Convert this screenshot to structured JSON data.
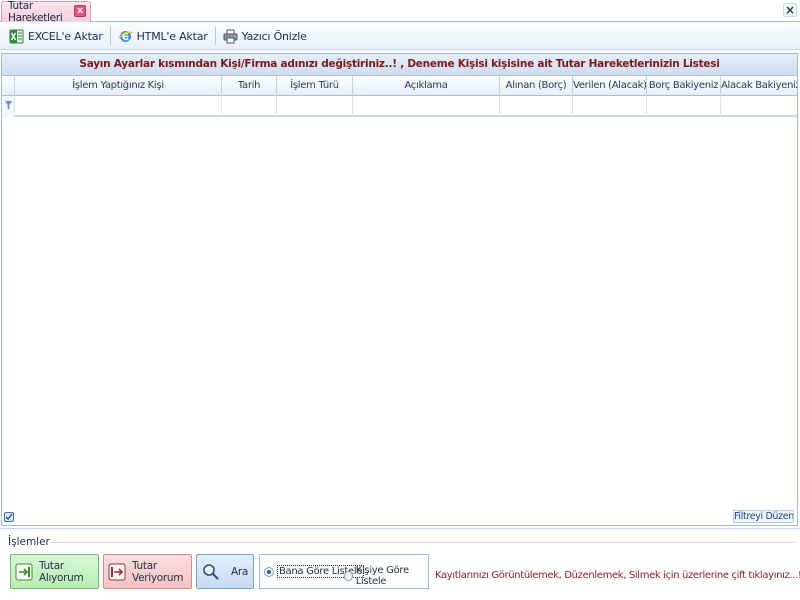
{
  "tab": {
    "title": "Tutar Hareketleri",
    "close_glyph": "x"
  },
  "window": {
    "close_glyph": "×"
  },
  "toolbar": {
    "excel_label": "EXCEL'e Aktar",
    "html_label": "HTML'e Aktar",
    "print_label": "Yazıcı Önizle"
  },
  "grid": {
    "caption": "Sayın Ayarlar kısmından Kişi/Firma adınızı değiştiriniz..! , Deneme Kişisi kişisine ait Tutar Hareketlerinizin Listesi",
    "columns": [
      "İşlem Yaptığınız Kişi",
      "Tarih",
      "İşlem Türü",
      "Açıklama",
      "Alınan (Borç)",
      "Verilen (Alacak)",
      "Borç Bakiyeniz",
      "Alacak Bakiyeniz"
    ],
    "filter_edit_label": "Filtreyi Düzenle"
  },
  "operations": {
    "title": "İşlemler",
    "btn_receiving": "Tutar Alıyorum",
    "btn_giving": "Tutar Veriyorum",
    "btn_search": "Ara",
    "radio_mine": "Bana Göre Listele",
    "radio_person": "Kişiye Göre Listele",
    "selected_radio": "Bana Göre Listele",
    "hint": "Kayıtlarınızı Görüntülemek, Düzenlemek, Silmek için üzerlerine çift tıklayınız...!"
  },
  "colors": {
    "caption_text": "#7a1a1a",
    "hint_text": "#8b1c1c",
    "tab_background": "#f6cfdc",
    "border_blue": "#9ebbdc"
  },
  "icons": [
    "excel-icon",
    "html-ie-icon",
    "printer-icon",
    "receive-icon",
    "give-icon",
    "search-icon",
    "filter-icon"
  ]
}
